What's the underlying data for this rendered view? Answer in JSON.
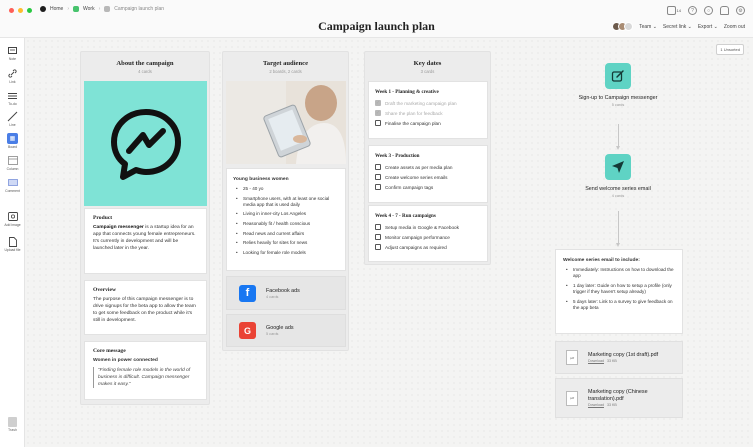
{
  "window": {
    "breadcrumbs": [
      "Home",
      "Work",
      "Campaign launch plan"
    ],
    "breadcrumb_colors": [
      "#1e1e1e",
      "#47c36d",
      "#b8b8b8"
    ],
    "title": "Campaign launch plan"
  },
  "header": {
    "notification_count": "14",
    "team_label": "Team",
    "secret_link_label": "Secret link",
    "export_label": "Export",
    "zoom_label": "Zoom out"
  },
  "sidebar": {
    "tools": [
      {
        "label": "Note",
        "icon": "note-icon"
      },
      {
        "label": "Link",
        "icon": "link-icon"
      },
      {
        "label": "To-do",
        "icon": "todo-icon"
      },
      {
        "label": "Line",
        "icon": "line-icon"
      },
      {
        "label": "Board",
        "icon": "board-icon"
      },
      {
        "label": "Column",
        "icon": "column-icon"
      },
      {
        "label": "Comment",
        "icon": "comment-icon"
      },
      {
        "label": "Add image",
        "icon": "image-icon"
      },
      {
        "label": "Upload file",
        "icon": "upload-icon"
      }
    ],
    "trash_label": "Trash"
  },
  "unsorted_label": "1 Unsorted",
  "columns": {
    "about": {
      "title": "About the campaign",
      "count": "4 cards",
      "image_color": "#7fe3d6",
      "product": {
        "heading": "Product",
        "bold": "Campaign messenger",
        "text": " is a startup idea for an app that connects young female entrepreneurs. It's currently in development and will be launched later in the year."
      },
      "overview": {
        "heading": "Overview",
        "text": "The purpose of this campaign messenger is to drive signups for the beta app to allow the team to get some feedback on the product while it's still in development."
      },
      "core": {
        "heading": "Core message",
        "subheading": "Women in power connected",
        "quote": "“Finding female role models in the world of business is difficult. Campaign messenger makes it easy.”"
      }
    },
    "audience": {
      "title": "Target audience",
      "count": "2 boards, 2 cards",
      "card_heading": "Young business women",
      "bullets": [
        "25 - 40 yo",
        "Smartphone users, with at least one social media app that is used daily",
        "Living in inner-city Los Angeles",
        "Reasonably fit / health conscious",
        "Read news and current affairs",
        "Relies heavily for sites for news",
        "Looking for female role models"
      ],
      "boards": [
        {
          "name": "Facebook ads",
          "count": "4 cards",
          "letter": "f",
          "color": "#1877f2"
        },
        {
          "name": "Google ads",
          "count": "5 cards",
          "letter": "G",
          "color": "#ea4335"
        }
      ]
    },
    "dates": {
      "title": "Key dates",
      "count": "3 cards",
      "weeks": [
        {
          "heading": "Week 1 - Planning & creative",
          "items": [
            {
              "text": "Draft the marketing campaign plan",
              "done": true
            },
            {
              "text": "Share the plan for feedback",
              "done": true
            },
            {
              "text": "Finalise the campaign plan",
              "done": false
            }
          ]
        },
        {
          "heading": "Week 3 - Production",
          "items": [
            {
              "text": "Create assets as per media plan",
              "done": false
            },
            {
              "text": "Create welcome series emails",
              "done": false
            },
            {
              "text": "Confirm campaign tags",
              "done": false
            }
          ]
        },
        {
          "heading": "Week 4 - 7 - Run campaigns",
          "items": [
            {
              "text": "Setup media in Google & Facebook",
              "done": false
            },
            {
              "text": "Monitor campaign performance",
              "done": false
            },
            {
              "text": "Adjust campaigns as required",
              "done": false
            }
          ]
        }
      ]
    }
  },
  "flow": {
    "step1": {
      "title": "Sign-up to Campaign messenger",
      "count": "5 cards"
    },
    "step2": {
      "title": "Send welcome series email",
      "count": "4 cards"
    },
    "accent": "#5fd3c4",
    "email": {
      "heading": "Welcome series email to include:",
      "bullets": [
        "Immediately: Instructions on how to download the app",
        "1 day later: Guide on how to setup a profile (only trigger if they haven't setup already)",
        "5 days later: Link to a survey to give feedback on the app beta"
      ]
    },
    "files": [
      {
        "name": "Marketing copy (1st draft).pdf",
        "action": "Download",
        "size": "33 KB"
      },
      {
        "name": "Marketing copy (Chinese translation).pdf",
        "action": "Download",
        "size": "33 KB"
      }
    ]
  }
}
